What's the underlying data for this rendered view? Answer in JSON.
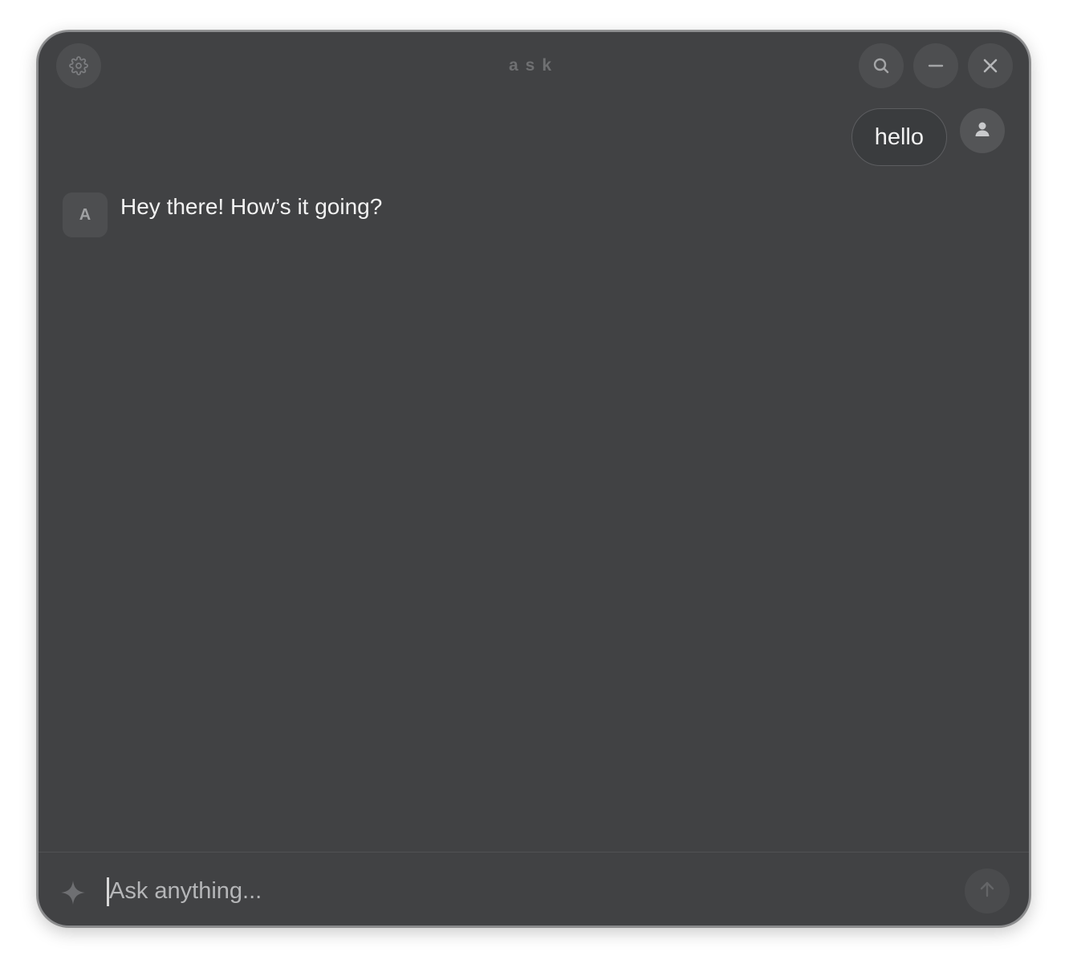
{
  "window": {
    "title": "ask"
  },
  "toolbar": {
    "settings_icon": "gear-icon",
    "search_icon": "search-icon",
    "minimize_icon": "minus-icon",
    "close_icon": "close-icon"
  },
  "messages": [
    {
      "role": "user",
      "text": "hello",
      "avatar_icon": "person-icon"
    },
    {
      "role": "assistant",
      "avatar_label": "A",
      "text": "Hey there! How’s it going?"
    }
  ],
  "composer": {
    "placeholder": "Ask anything...",
    "value": "",
    "leading_icon": "sparkle-icon",
    "send_icon": "arrow-up-icon"
  },
  "colors": {
    "window_bg": "#414244",
    "button_bg": "#4d4e50",
    "user_bubble_bg": "#3a3c3e",
    "text": "#f2f2f2"
  }
}
